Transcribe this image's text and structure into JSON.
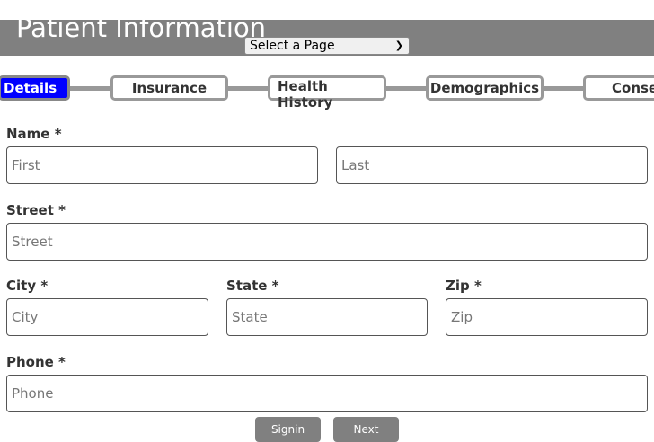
{
  "header": {
    "title": "Patient Information",
    "page_select": {
      "selected": "Select a Page"
    }
  },
  "steps": [
    {
      "label": "Details",
      "active": true
    },
    {
      "label": "Insurance"
    },
    {
      "label": "Health History"
    },
    {
      "label": "Demographics"
    },
    {
      "label": "Consent"
    }
  ],
  "form": {
    "name": {
      "label": "Name *",
      "first_placeholder": "First",
      "last_placeholder": "Last"
    },
    "street": {
      "label": "Street *",
      "placeholder": "Street"
    },
    "city": {
      "label": "City *",
      "placeholder": "City"
    },
    "state": {
      "label": "State *",
      "placeholder": "State"
    },
    "zip": {
      "label": "Zip *",
      "placeholder": "Zip"
    },
    "phone": {
      "label": "Phone *",
      "placeholder": "Phone"
    }
  },
  "buttons": {
    "signin": "Signin",
    "next": "Next"
  },
  "colors": {
    "active_step": "#0000ff",
    "header_band": "#808080",
    "button": "#808080"
  }
}
